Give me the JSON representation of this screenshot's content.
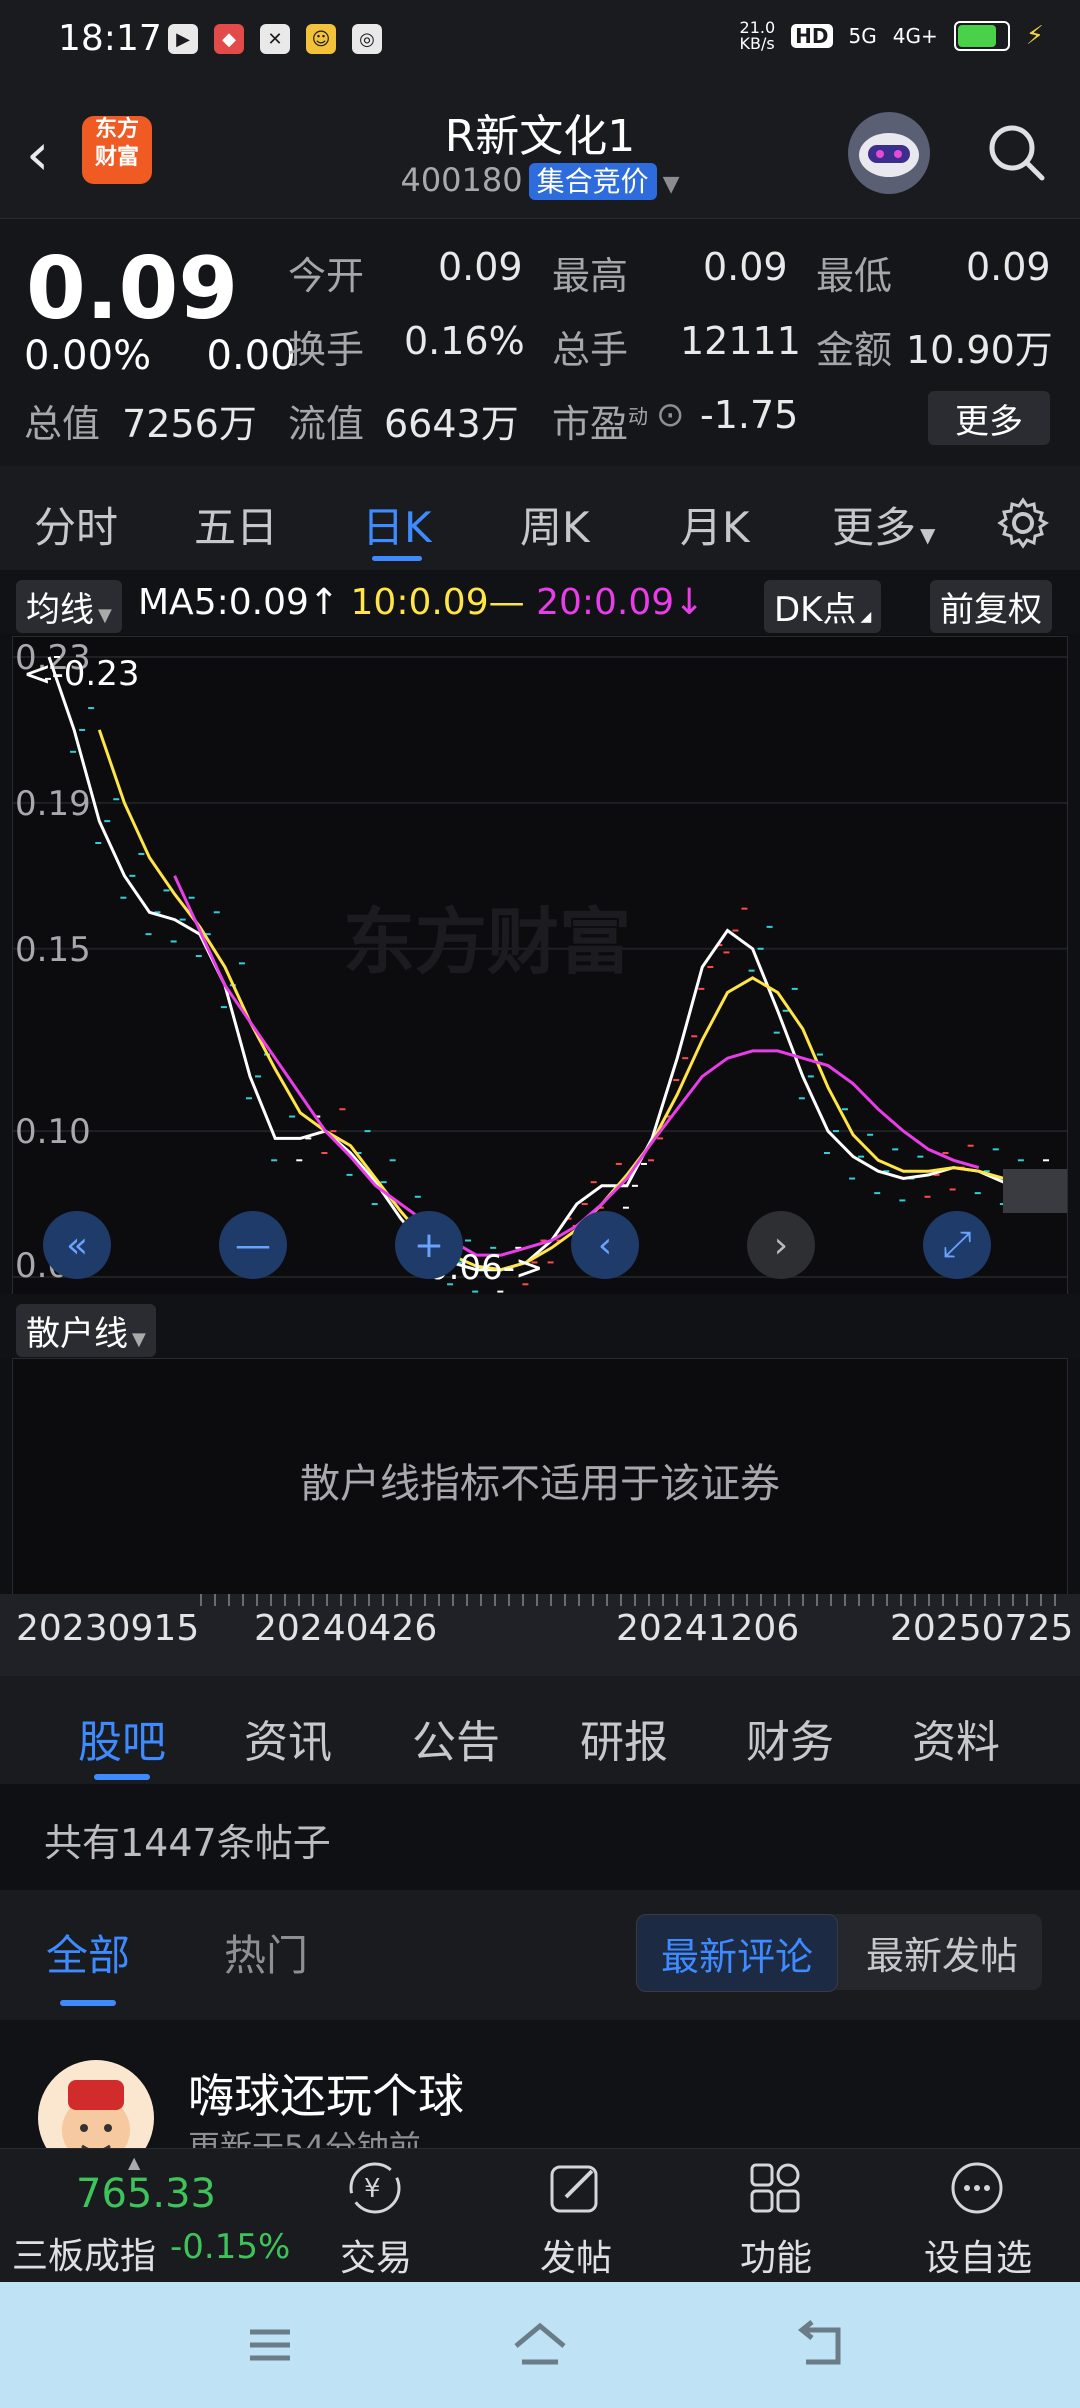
{
  "status": {
    "time": "18:17",
    "net_speed": "21.0\nKB/s",
    "hd": "HD",
    "sig1": "5G",
    "sig2": "4G+"
  },
  "header": {
    "title": "R新文化1",
    "code": "400180",
    "tag": "集合竞价",
    "logo": "东方\n财富"
  },
  "quote": {
    "price": "0.09",
    "change_pct": "0.00%",
    "change": "0.00",
    "total_cap_label": "总值",
    "total_cap": "7256万",
    "open_label": "今开",
    "open": "0.09",
    "high_label": "最高",
    "high": "0.09",
    "low_label": "最低",
    "low": "0.09",
    "turnover_label": "换手",
    "turnover": "0.16%",
    "volume_label": "总手",
    "volume": "12111",
    "amount_label": "金额",
    "amount": "10.90万",
    "float_label": "流值",
    "float_cap": "6643万",
    "pe_label": "市盈",
    "pe_sup": "动",
    "pe": "-1.75",
    "more": "更多"
  },
  "period_tabs": [
    "分时",
    "五日",
    "日K",
    "周K",
    "月K",
    "更多"
  ],
  "chart_header": {
    "indicator": "均线",
    "ma5": "MA5:0.09",
    "ma10": "10:0.09",
    "ma20": "20:0.09",
    "dk": "DK点",
    "adjust": "前复权",
    "max_label": "<-0.23",
    "min_label": "0.06->",
    "watermark": "东方财富"
  },
  "chart_data": {
    "type": "line",
    "ylim": [
      0.06,
      0.23
    ],
    "y_ticks": [
      "0.23",
      "0.19",
      "0.15",
      "0.10",
      "0.06"
    ],
    "series": [
      {
        "name": "MA5",
        "color": "#ffffff",
        "values": [
          0.23,
          0.21,
          0.185,
          0.17,
          0.16,
          0.158,
          0.154,
          0.14,
          0.115,
          0.098,
          0.098,
          0.1,
          0.094,
          0.086,
          0.076,
          0.068,
          0.064,
          0.062,
          0.062,
          0.064,
          0.07,
          0.08,
          0.085,
          0.085,
          0.098,
          0.12,
          0.145,
          0.155,
          0.15,
          0.133,
          0.115,
          0.1,
          0.093,
          0.089,
          0.087,
          0.088,
          0.09,
          0.089,
          0.086,
          0.086
        ]
      },
      {
        "name": "MA10",
        "color": "#ffe547",
        "values": [
          null,
          null,
          0.21,
          0.19,
          0.175,
          0.165,
          0.156,
          0.145,
          0.13,
          0.117,
          0.105,
          0.1,
          0.096,
          0.087,
          0.078,
          0.07,
          0.066,
          0.063,
          0.062,
          0.064,
          0.068,
          0.073,
          0.08,
          0.088,
          0.097,
          0.11,
          0.125,
          0.138,
          0.142,
          0.138,
          0.128,
          0.112,
          0.099,
          0.092,
          0.089,
          0.089,
          0.09,
          0.089,
          0.087,
          0.088
        ]
      },
      {
        "name": "MA20",
        "color": "#e83de8",
        "values": [
          null,
          null,
          null,
          null,
          null,
          0.17,
          0.155,
          0.14,
          0.13,
          0.12,
          0.11,
          0.1,
          0.093,
          0.085,
          0.08,
          0.075,
          0.07,
          0.066,
          0.066,
          0.068,
          0.07,
          0.074,
          0.08,
          0.087,
          0.097,
          0.106,
          0.115,
          0.12,
          0.122,
          0.122,
          0.12,
          0.118,
          0.113,
          0.106,
          0.1,
          0.095,
          0.092,
          0.09
        ]
      }
    ]
  },
  "indicator": {
    "name": "散户线",
    "message": "散户线指标不适用于该证券"
  },
  "dates": [
    "20230915",
    "20240426",
    "20241206",
    "20250725"
  ],
  "content_tabs": [
    "股吧",
    "资讯",
    "公告",
    "研报",
    "财务",
    "资料"
  ],
  "post_count": "共有1447条帖子",
  "sub_tabs": [
    "全部",
    "热门"
  ],
  "sort": [
    "最新评论",
    "最新发帖"
  ],
  "post": {
    "name": "嗨球还玩个球",
    "time": "更新于54分钟前"
  },
  "bottom": {
    "index_value": "765.33",
    "index_name": "三板成指",
    "index_change": "-0.15%",
    "items": [
      "交易",
      "发帖",
      "功能",
      "设自选"
    ]
  }
}
